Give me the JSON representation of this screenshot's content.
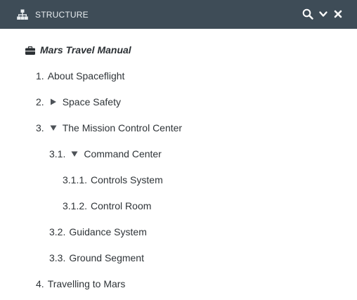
{
  "header": {
    "title": "STRUCTURE",
    "background": "#3e4c57",
    "icons": {
      "structure": "sitemap-icon",
      "search": "search-icon",
      "collapse": "chevron-down-icon",
      "close": "close-icon"
    }
  },
  "tree": {
    "root": {
      "label": "Mars Travel Manual",
      "icon": "briefcase-icon"
    },
    "items": [
      {
        "number": "1.",
        "label": "About Spaceflight",
        "toggle": "none"
      },
      {
        "number": "2.",
        "label": "Space Safety",
        "toggle": "collapsed"
      },
      {
        "number": "3.",
        "label": "The Mission Control Center",
        "toggle": "expanded"
      },
      {
        "number": "3.1.",
        "label": "Command Center",
        "toggle": "expanded"
      },
      {
        "number": "3.1.1.",
        "label": "Controls System",
        "toggle": "none"
      },
      {
        "number": "3.1.2.",
        "label": "Control Room",
        "toggle": "none"
      },
      {
        "number": "3.2.",
        "label": "Guidance System",
        "toggle": "none"
      },
      {
        "number": "3.3.",
        "label": "Ground Segment",
        "toggle": "none"
      },
      {
        "number": "4.",
        "label": "Travelling to Mars",
        "toggle": "none"
      }
    ]
  }
}
